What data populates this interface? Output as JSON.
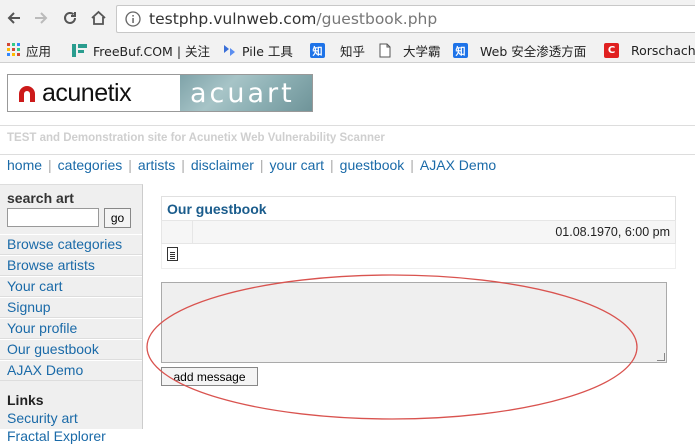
{
  "browser": {
    "url_host": "testphp.vulnweb.com",
    "url_path": "/guestbook.php",
    "bookmarks": [
      {
        "label": "应用",
        "icon": "apps-grid-icon"
      },
      {
        "label": "FreeBuf.COM | 关注",
        "icon": "freebuf-icon"
      },
      {
        "label": "Pile 工具",
        "icon": "pile-icon"
      },
      {
        "label": "知乎",
        "icon": "zhihu-icon"
      },
      {
        "label": "大学霸",
        "icon": "page-icon"
      },
      {
        "label": "Web 安全渗透方面",
        "icon": "zhihu-icon"
      },
      {
        "label": "Rorschach_",
        "icon": "csdn-icon"
      }
    ],
    "zhihu_glyph": "知",
    "csdn_glyph": "C"
  },
  "site": {
    "logo_left": "acunetix",
    "logo_right": "acuart",
    "tagline": "TEST and Demonstration site for Acunetix Web Vulnerability Scanner",
    "menu": [
      "home",
      "categories",
      "artists",
      "disclaimer",
      "your cart",
      "guestbook",
      "AJAX Demo"
    ],
    "menu_separator": "|"
  },
  "sidebar": {
    "search_title": "search art",
    "go_label": "go",
    "links": [
      "Browse categories",
      "Browse artists",
      "Your cart",
      "Signup",
      "Your profile",
      "Our guestbook",
      "AJAX Demo"
    ],
    "links_title": "Links",
    "links_section": [
      "Security art",
      "Fractal Explorer"
    ]
  },
  "guestbook": {
    "title": "Our guestbook",
    "date": "01.08.1970, 6:00 pm",
    "submit_label": "add message"
  },
  "annotation_color": "#d9534f"
}
